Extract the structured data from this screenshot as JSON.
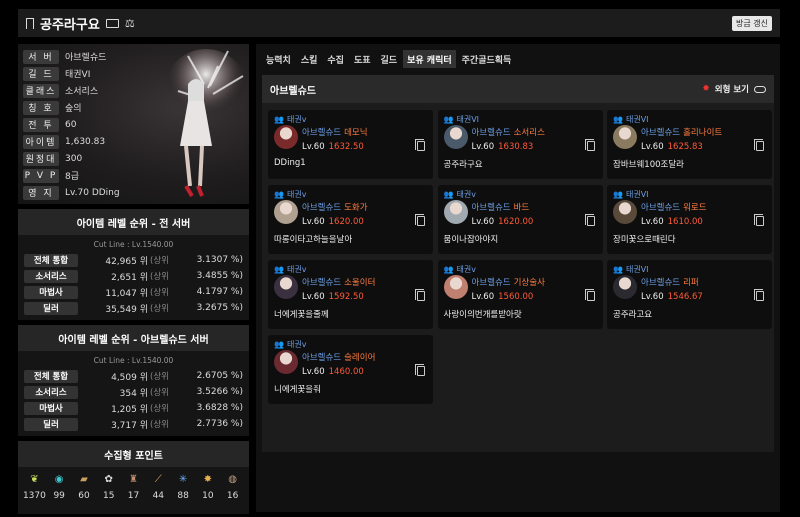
{
  "header": {
    "title": "공주라구요",
    "refresh_label": "방금 갱신",
    "icons": [
      "bookmark-icon",
      "id-card-icon",
      "scale-icon"
    ]
  },
  "profile": {
    "rows": [
      {
        "label": "서 버",
        "value": "아브렐슈드"
      },
      {
        "label": "길 드",
        "value": "태권VI"
      },
      {
        "label": "클래스",
        "value": "소서리스"
      },
      {
        "label": "칭 호",
        "value": "숲의"
      },
      {
        "label": "전 투",
        "value": "60"
      },
      {
        "label": "아이템",
        "value": "1,630.83"
      },
      {
        "label": "원정대",
        "value": "300"
      },
      {
        "label": "P V P",
        "value": "8급"
      },
      {
        "label": "영 지",
        "value": "Lv.70 DDing"
      }
    ]
  },
  "rank_all": {
    "title": "아이템 레벨 순위 - 전 서버",
    "cutline": "Cut Line : Lv.1540.00",
    "rows": [
      {
        "label": "전체 통합",
        "num": "42,965 위",
        "sub": "(상위",
        "pct": "3.1307 %)"
      },
      {
        "label": "소서리스",
        "num": "2,651 위",
        "sub": "(상위",
        "pct": "3.4855 %)"
      },
      {
        "label": "마법사",
        "num": "11,047 위",
        "sub": "(상위",
        "pct": "4.1797 %)"
      },
      {
        "label": "딜러",
        "num": "35,549 위",
        "sub": "(상위",
        "pct": "3.2675 %)"
      }
    ]
  },
  "rank_server": {
    "title": "아이템 레벨 순위 - 아브렐슈드 서버",
    "cutline": "Cut Line : Lv.1540.00",
    "rows": [
      {
        "label": "전체 통합",
        "num": "4,509 위",
        "sub": "(상위",
        "pct": "2.6705 %)"
      },
      {
        "label": "소서리스",
        "num": "354 위",
        "sub": "(상위",
        "pct": "3.5266 %)"
      },
      {
        "label": "마법사",
        "num": "1,205 위",
        "sub": "(상위",
        "pct": "3.6828 %)"
      },
      {
        "label": "딜러",
        "num": "3,717 위",
        "sub": "(상위",
        "pct": "2.7736 %)"
      }
    ]
  },
  "collect": {
    "title": "수집형 포인트",
    "items": [
      {
        "icon": "seed-icon",
        "value": "1370",
        "color": "#c8e060"
      },
      {
        "icon": "island-icon",
        "value": "99",
        "color": "#40c8d0"
      },
      {
        "icon": "card-icon",
        "value": "60",
        "color": "#c8a060"
      },
      {
        "icon": "heart-icon",
        "value": "15",
        "color": "#d8d8d8"
      },
      {
        "icon": "art-icon",
        "value": "17",
        "color": "#c09070"
      },
      {
        "icon": "sword-icon",
        "value": "44",
        "color": "#e0b060"
      },
      {
        "icon": "leaf-icon",
        "value": "88",
        "color": "#6ab0ff"
      },
      {
        "icon": "medal-icon",
        "value": "10",
        "color": "#e8b048"
      },
      {
        "icon": "shell-icon",
        "value": "16",
        "color": "#c0a080"
      }
    ]
  },
  "tabs": [
    {
      "label": "능력치",
      "active": false
    },
    {
      "label": "스킬",
      "active": false
    },
    {
      "label": "수집",
      "active": false
    },
    {
      "label": "도표",
      "active": false
    },
    {
      "label": "길드",
      "active": false
    },
    {
      "label": "보유 캐릭터",
      "active": true
    },
    {
      "label": "주간골드획득",
      "active": false
    }
  ],
  "panel": {
    "title": "아브렐슈드",
    "toggle_label": "외형 보기"
  },
  "characters": [
    {
      "guild": "태권v",
      "server": "아브렐슈드",
      "class": "데모닉",
      "level": "Lv.60",
      "ilvl": "1632.50",
      "name": "DDing1",
      "avatar": "#7a2a2a"
    },
    {
      "guild": "태권VI",
      "server": "아브렐슈드",
      "class": "소서리스",
      "level": "Lv.60",
      "ilvl": "1630.83",
      "name": "공주라구요",
      "avatar": "#4a5a6a"
    },
    {
      "guild": "태권VI",
      "server": "아브렐슈드",
      "class": "홀리나이트",
      "level": "Lv.60",
      "ilvl": "1625.83",
      "name": "잠바브웨100조달라",
      "avatar": "#8a7a60"
    },
    {
      "guild": "태권v",
      "server": "아브렐슈드",
      "class": "도화가",
      "level": "Lv.60",
      "ilvl": "1620.00",
      "name": "따롱이타고하늘을날아",
      "avatar": "#b0a090"
    },
    {
      "guild": "태권v",
      "server": "아브렐슈드",
      "class": "바드",
      "level": "Lv.60",
      "ilvl": "1620.00",
      "name": "뭄이나잡아야지",
      "avatar": "#a0a8b0"
    },
    {
      "guild": "태권VI",
      "server": "아브렐슈드",
      "class": "워로드",
      "level": "Lv.60",
      "ilvl": "1610.00",
      "name": "장미꽃으로때린다",
      "avatar": "#5a4a3a"
    },
    {
      "guild": "태권v",
      "server": "아브렐슈드",
      "class": "소울이터",
      "level": "Lv.60",
      "ilvl": "1592.50",
      "name": "너에게꽃을줄께",
      "avatar": "#3a3040"
    },
    {
      "guild": "태권v",
      "server": "아브렐슈드",
      "class": "기상술사",
      "level": "Lv.60",
      "ilvl": "1560.00",
      "name": "사랑이의번개를받아랏",
      "avatar": "#c08070"
    },
    {
      "guild": "태권VI",
      "server": "아브렐슈드",
      "class": "리퍼",
      "level": "Lv.60",
      "ilvl": "1546.67",
      "name": "공주라고요",
      "avatar": "#2a2a30"
    },
    {
      "guild": "태권v",
      "server": "아브렐슈드",
      "class": "슬레이어",
      "level": "Lv.60",
      "ilvl": "1460.00",
      "name": "니에게꽃을줘",
      "avatar": "#6a2a30"
    }
  ]
}
